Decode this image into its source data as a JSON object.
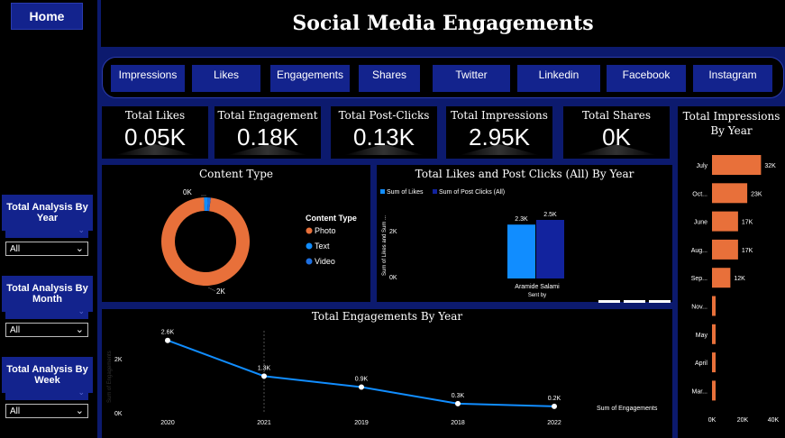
{
  "page": {
    "title": "Social Media Engagements",
    "home_label": "Home"
  },
  "filters": [
    {
      "title": "Total Analysis By Year",
      "value": "All"
    },
    {
      "title": "Total Analysis By Month",
      "value": "All"
    },
    {
      "title": "Total Analysis By Week",
      "value": "All"
    }
  ],
  "nav": [
    "Impressions",
    "Likes",
    "Engagements",
    "Shares",
    "Twitter",
    "Linkedin",
    "Facebook",
    "Instagram"
  ],
  "kpis": [
    {
      "label": "Total Likes",
      "value": "0.05K"
    },
    {
      "label": "Total Engagement",
      "value": "0.18K"
    },
    {
      "label": "Total Post-Clicks",
      "value": "0.13K"
    },
    {
      "label": "Total Impressions",
      "value": "2.95K"
    },
    {
      "label": "Total Shares",
      "value": "0K"
    }
  ],
  "colors": {
    "orange": "#e8703a",
    "blue_light": "#118dff",
    "blue_dark": "#12239e",
    "photo": "#e8703a",
    "text": "#118dff",
    "video": "#1e6fe0"
  },
  "chart_data": [
    {
      "id": "content_type",
      "type": "pie",
      "title": "Content Type",
      "legend_title": "Content Type",
      "labels": [
        "Photo",
        "Text",
        "Video"
      ],
      "values": [
        2000,
        30,
        20
      ],
      "data_labels": [
        "2K",
        "0K"
      ]
    },
    {
      "id": "likes_clicks",
      "type": "bar",
      "title": "Total Likes and Post Clicks (All) By Year",
      "categories": [
        "Aramide Salami"
      ],
      "xlabel": "Sent by",
      "ylabel": "Sum of Likes and Sum ...",
      "ylim": [
        0,
        3000
      ],
      "yticks": [
        "0K",
        "2K"
      ],
      "series": [
        {
          "name": "Sum of Likes",
          "values": [
            2300
          ],
          "label": "2.3K"
        },
        {
          "name": "Sum of Post Clicks (All)",
          "values": [
            2500
          ],
          "label": "2.5K"
        }
      ]
    },
    {
      "id": "engagements_year",
      "type": "line",
      "title": "Total Engagements By Year",
      "categories": [
        "2020",
        "2021",
        "2019",
        "2018",
        "2022"
      ],
      "values": [
        2600,
        1300,
        900,
        300,
        200
      ],
      "labels": [
        "2.6K",
        "1.3K",
        "0.9K",
        "0.3K",
        "0.2K"
      ],
      "ylabel": "Sum of Engagements",
      "yticks": [
        "0K",
        "2K"
      ],
      "ylim": [
        0,
        3000
      ],
      "legend": "Sum of Engagements"
    },
    {
      "id": "impressions_year",
      "type": "bar",
      "title": "Total Impressions By Year",
      "categories": [
        "July",
        "Oct...",
        "June",
        "Aug...",
        "Sep...",
        "Nov...",
        "May",
        "April",
        "Mar..."
      ],
      "values": [
        32000,
        23000,
        17000,
        17000,
        12000,
        1000,
        800,
        600,
        500
      ],
      "labels": [
        "32K",
        "23K",
        "17K",
        "17K",
        "12K",
        "",
        "",
        "",
        ""
      ],
      "xticks": [
        "0K",
        "20K",
        "40K"
      ],
      "xlim": [
        0,
        40000
      ]
    }
  ]
}
